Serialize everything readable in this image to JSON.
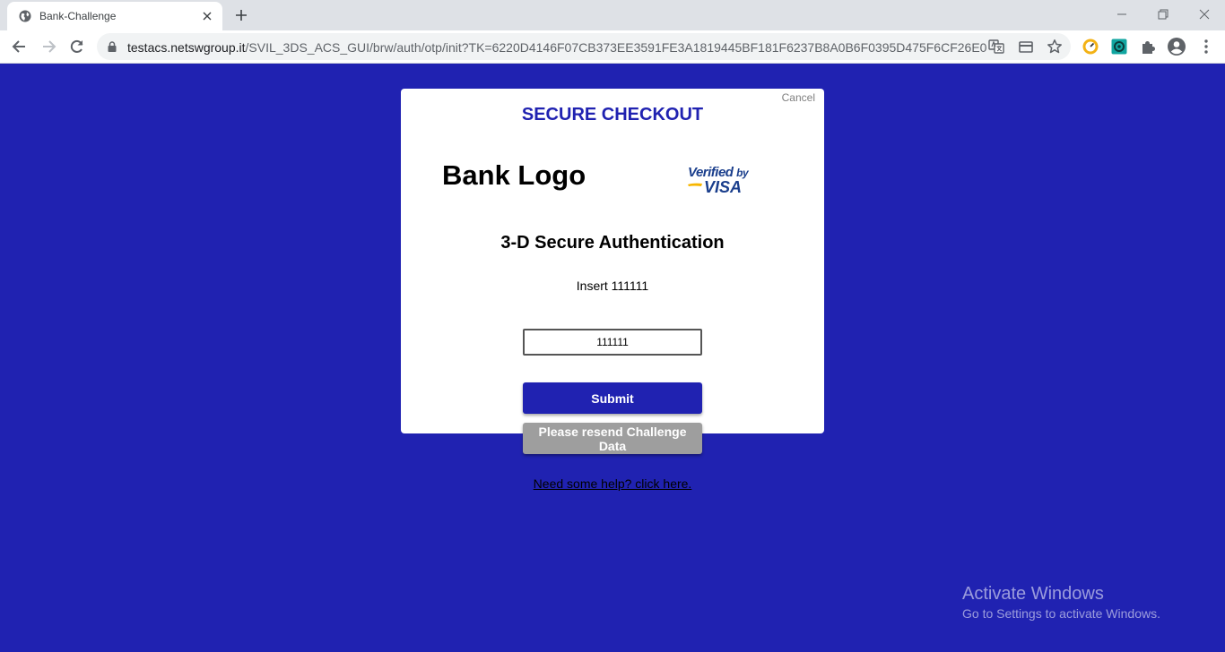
{
  "browser": {
    "tab_title": "Bank-Challenge",
    "url_host": "testacs.netswgroup.it",
    "url_path": "/SVIL_3DS_ACS_GUI/brw/auth/otp/init?TK=6220D4146F07CB373EE3591FE3A1819445BF181F6237B8A0B6F0395D475F6CF26E0AF9F..."
  },
  "page": {
    "cancel_label": "Cancel",
    "checkout_title": "SECURE CHECKOUT",
    "bank_logo_text": "Bank Logo",
    "visa_logo": {
      "verified": "Verified",
      "by": "by",
      "brand": "VISA"
    },
    "auth_title": "3-D Secure Authentication",
    "instruction": "Insert 111111",
    "otp_value": "111111",
    "submit_label": "Submit",
    "resend_label": "Please resend Challenge Data",
    "help_link": "Need some help? click here."
  },
  "os_watermark": {
    "title": "Activate Windows",
    "subtitle": "Go to Settings to activate Windows."
  },
  "colors": {
    "page_background": "#2022b1",
    "primary_button": "#2022b1",
    "secondary_button": "#9e9e9e",
    "visa_blue": "#1a3e8c"
  }
}
